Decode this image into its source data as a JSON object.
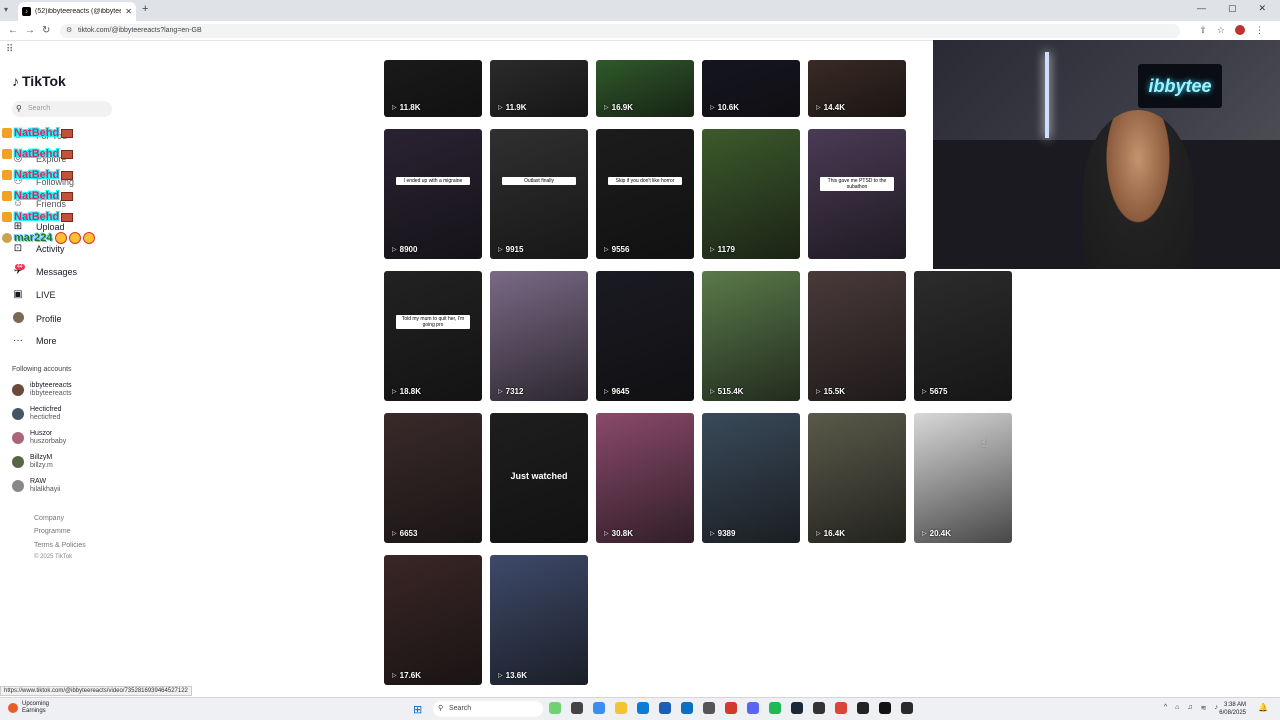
{
  "browser": {
    "tab_title": "(52)ibbyteereacts (@ibbyteer...",
    "url": "tiktok.com/@ibbyteereacts?lang=en-GB",
    "status_url": "https://www.tiktok.com/@ibbyteereacts/video/7352816939464527122"
  },
  "sidebar": {
    "logo": "TikTok",
    "search_placeholder": "Search",
    "nav": [
      {
        "label": "For You",
        "icon": "home-icon"
      },
      {
        "label": "Explore",
        "icon": "compass-icon"
      },
      {
        "label": "Following",
        "icon": "following-icon"
      },
      {
        "label": "Friends",
        "icon": "friends-icon"
      },
      {
        "label": "Upload",
        "icon": "upload-icon"
      },
      {
        "label": "Activity",
        "icon": "activity-icon"
      },
      {
        "label": "Messages",
        "icon": "messages-icon",
        "badge": "44"
      },
      {
        "label": "LIVE",
        "icon": "live-icon"
      },
      {
        "label": "Profile",
        "icon": "profile-icon"
      },
      {
        "label": "More",
        "icon": "more-icon"
      }
    ],
    "following_heading": "Following accounts",
    "accounts": [
      {
        "display": "ibbyteereacts",
        "handle": "ibbyteereacts",
        "color": "#6a4a3a"
      },
      {
        "display": "Hecticfred",
        "handle": "hecticfred",
        "color": "#445566"
      },
      {
        "display": "Huszor",
        "handle": "huszorbaby",
        "color": "#aa6677"
      },
      {
        "display": "BillzyM",
        "handle": "billzy.m",
        "color": "#556644"
      },
      {
        "display": "RAW",
        "handle": "hilalkhayii",
        "color": "#888888"
      }
    ],
    "footer": [
      "Company",
      "Programme",
      "Terms & Policies"
    ],
    "copyright": "© 2025 TikTok"
  },
  "chat_overlay": [
    {
      "name": "NatBehd",
      "style": "red"
    },
    {
      "name": "NatBehd",
      "style": "red"
    },
    {
      "name": "NatBehd",
      "style": "red"
    },
    {
      "name": "NatBehd",
      "style": "red"
    },
    {
      "name": "NatBehd",
      "style": "red"
    },
    {
      "name": "mar224",
      "style": "green"
    }
  ],
  "videos": [
    {
      "views": "11.8K",
      "bg": "#1a1a1a"
    },
    {
      "views": "11.9K",
      "bg": "#2b2b2b"
    },
    {
      "views": "16.9K",
      "bg": "#2f5a2a"
    },
    {
      "views": "10.6K",
      "bg": "#151520"
    },
    {
      "views": "14.4K",
      "bg": "#3a2a24"
    },
    {
      "views": "8900",
      "bg": "#2a2233",
      "caption": "I ended up with a migraine"
    },
    {
      "views": "9915",
      "bg": "#303030",
      "caption": "Outlast finally"
    },
    {
      "views": "9556",
      "bg": "#1c1c1c",
      "caption": "Skip if you don't like horror"
    },
    {
      "views": "1179",
      "bg": "#3d5a2c"
    },
    {
      "views": "",
      "bg": "#4a3b55",
      "caption": "This gave me PTSD to the subathon"
    },
    {
      "views": "18.8K",
      "bg": "#222222",
      "caption": "Told my mum to quit her, I'm going pro"
    },
    {
      "views": "7312",
      "bg": "#7a6a86"
    },
    {
      "views": "9645",
      "bg": "#1a1a22"
    },
    {
      "views": "515.4K",
      "bg": "#5a7a4a"
    },
    {
      "views": "15.5K",
      "bg": "#4a3a3a"
    },
    {
      "views": "5675",
      "bg": "#2c2c2c"
    },
    {
      "views": "6653",
      "bg": "#3a2a2a"
    },
    {
      "views": "",
      "bg": "#1e1e1e",
      "watched": "Just watched"
    },
    {
      "views": "30.8K",
      "bg": "#8a4a6a"
    },
    {
      "views": "9389",
      "bg": "#3a4a5a"
    },
    {
      "views": "16.4K",
      "bg": "#5a5a4a"
    },
    {
      "views": "20.4K",
      "bg": "#d8d8d8"
    },
    {
      "views": "17.6K",
      "bg": "#3a2626"
    },
    {
      "views": "13.6K",
      "bg": "#3e4a6a"
    }
  ],
  "webcam": {
    "sign": "ibbytee"
  },
  "taskbar": {
    "weather_line1": "Upcoming",
    "weather_line2": "Earnings",
    "search": "Search",
    "time": "3:38 AM",
    "date": "6/08/2025"
  }
}
